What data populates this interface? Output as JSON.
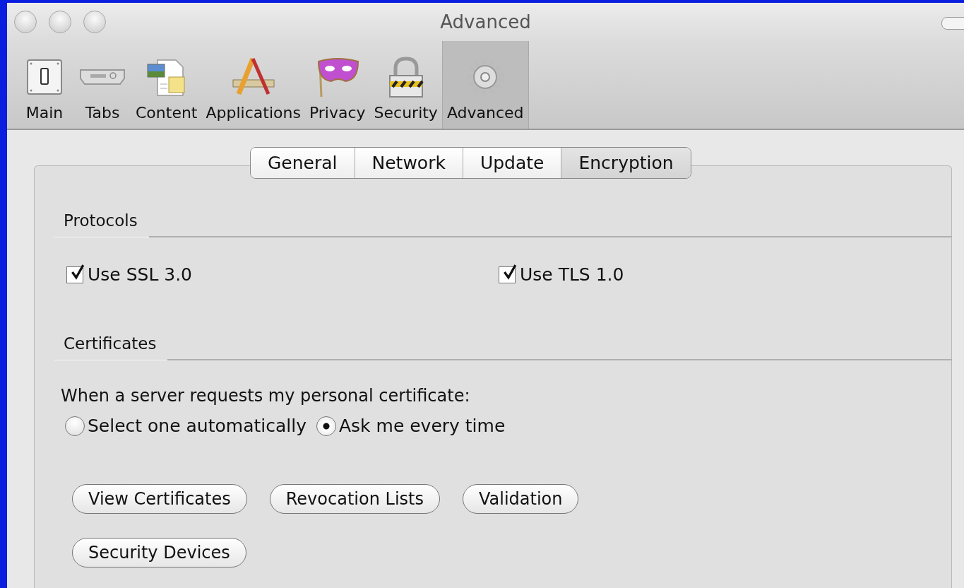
{
  "window": {
    "title": "Advanced"
  },
  "toolbar": [
    {
      "label": "Main",
      "kind": "switch",
      "selected": false
    },
    {
      "label": "Tabs",
      "kind": "tabs",
      "selected": false
    },
    {
      "label": "Content",
      "kind": "content",
      "selected": false
    },
    {
      "label": "Applications",
      "kind": "applications",
      "selected": false
    },
    {
      "label": "Privacy",
      "kind": "mask",
      "selected": false
    },
    {
      "label": "Security",
      "kind": "lock",
      "selected": false
    },
    {
      "label": "Advanced",
      "kind": "gear",
      "selected": true
    }
  ],
  "tabs": [
    {
      "label": "General",
      "selected": false
    },
    {
      "label": "Network",
      "selected": false
    },
    {
      "label": "Update",
      "selected": false
    },
    {
      "label": "Encryption",
      "selected": true
    }
  ],
  "protocols": {
    "heading": "Protocols",
    "options": [
      {
        "label": "Use SSL 3.0",
        "checked": true
      },
      {
        "label": "Use TLS 1.0",
        "checked": true
      }
    ]
  },
  "certificates": {
    "heading": "Certificates",
    "prompt": "When a server requests my personal certificate:",
    "choices": [
      {
        "label": "Select one automatically",
        "selected": false
      },
      {
        "label": "Ask me every time",
        "selected": true
      }
    ],
    "buttons": [
      [
        "View Certificates",
        "Revocation Lists",
        "Validation"
      ],
      [
        "Security Devices"
      ]
    ]
  }
}
